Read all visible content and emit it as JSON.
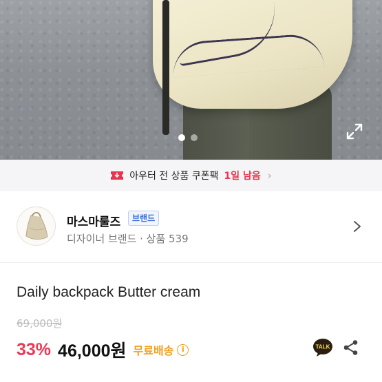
{
  "coupon": {
    "prefix": "아우터 전 상품 쿠폰팩",
    "highlight": "1일 남음",
    "arrow": "›"
  },
  "seller": {
    "name": "마스마룰즈",
    "badge": "브랜드",
    "subtitle": "디자이너 브랜드 · 상품 539"
  },
  "product": {
    "title": "Daily backpack  Butter cream",
    "original_price": "69,000원",
    "discount": "33%",
    "price": "46,000원",
    "shipping": "무료배송",
    "info_glyph": "i"
  },
  "gallery": {
    "total": 2,
    "current": 1
  },
  "colors": {
    "discount": "#ec3a56",
    "shipping": "#f0a020",
    "brand_badge": "#3c6ed8",
    "coupon_highlight": "#e8344e"
  },
  "icons": [
    "expand-icon",
    "coupon-icon",
    "chevron-right-icon",
    "kakaotalk-icon",
    "share-icon",
    "info-icon"
  ]
}
